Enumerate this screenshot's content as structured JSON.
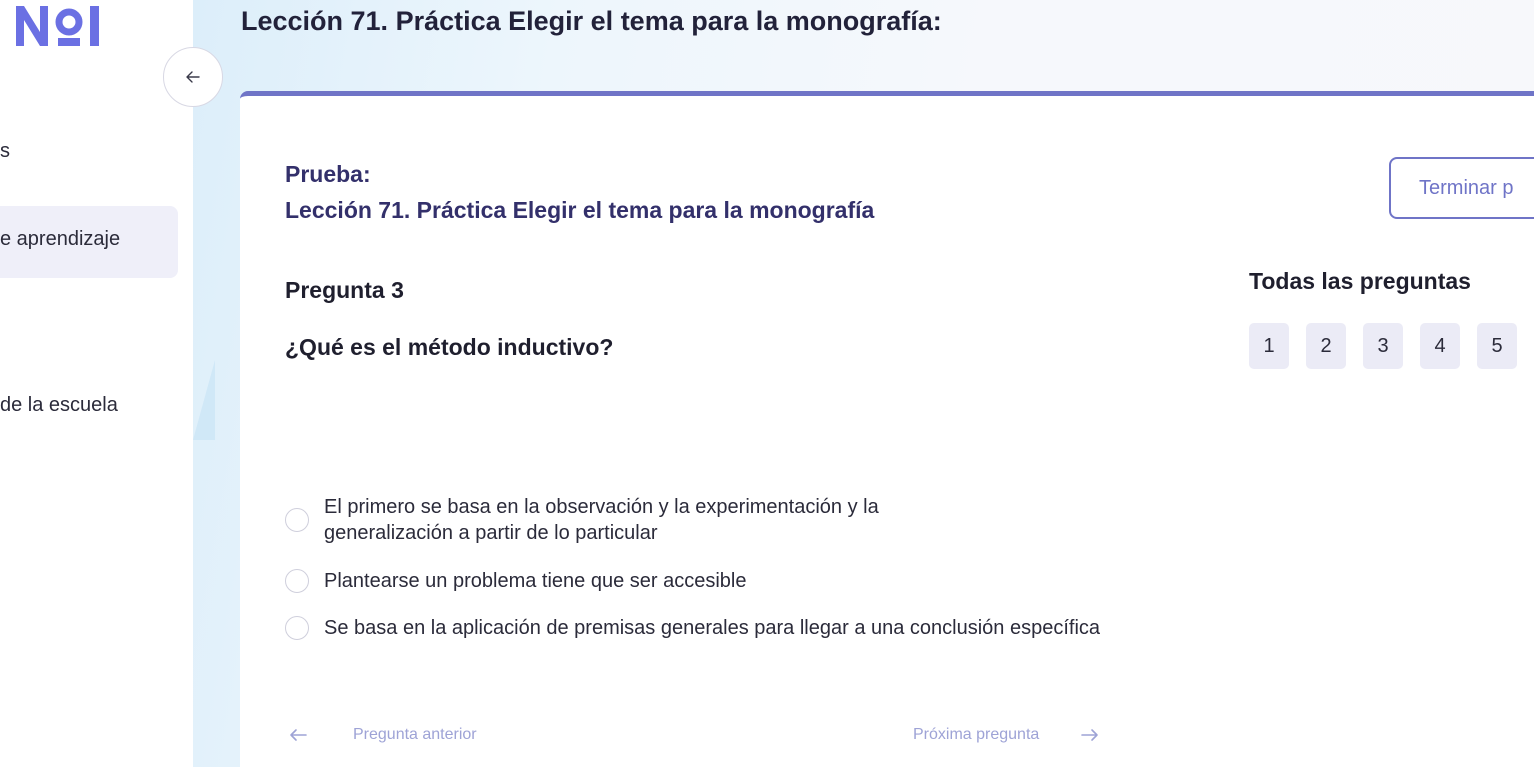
{
  "sidebar": {
    "logo_text": "NoI",
    "fragment_top": "s",
    "active_item": "e aprendizaje",
    "fragment_bottom": "de la escuela",
    "collapse_icon": "arrow-left-icon"
  },
  "header": {
    "title": "Lección 71. Práctica Elegir el tema para la monografía:"
  },
  "test": {
    "label": "Prueba:",
    "name": "Lección 71. Práctica Elegir el tema para la monografía",
    "finish_button": "Terminar p"
  },
  "question": {
    "number_label": "Pregunta 3",
    "text": "¿Qué es el método inductivo?",
    "options": [
      "El primero se basa en la observación y la experimentación y la generalización a partir de lo particular",
      "Plantearse un problema tiene que ser accesible",
      "Se basa en la aplicación de premisas generales para llegar a una conclusión específica"
    ]
  },
  "all_questions": {
    "title": "Todas las preguntas",
    "items": [
      "1",
      "2",
      "3",
      "4",
      "5"
    ]
  },
  "navigation": {
    "prev_label": "Pregunta anterior",
    "next_label": "Próxima pregunta"
  },
  "colors": {
    "accent": "#6f74c7",
    "logo": "#6b70e3",
    "title_dark": "#33306b"
  }
}
